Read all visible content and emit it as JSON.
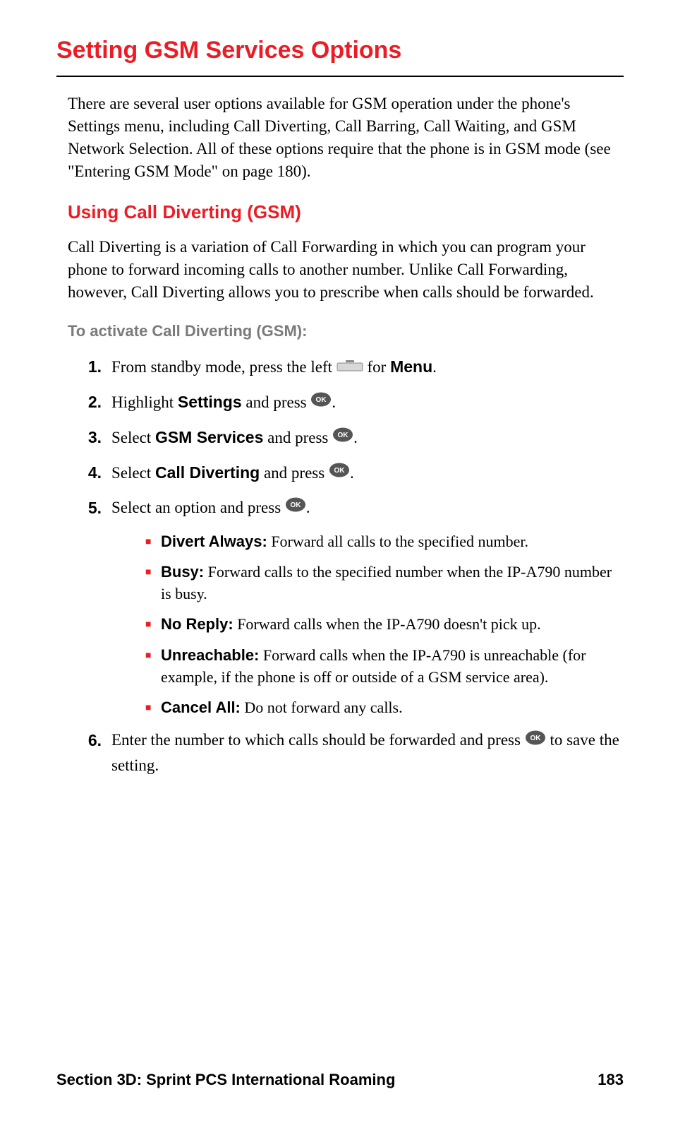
{
  "heading1": "Setting GSM Services Options",
  "intro": "There are several user options available for GSM operation under the phone's Settings menu, including Call Diverting, Call Barring, Call Waiting, and GSM Network Selection. All of these options require that the phone is in GSM mode (see \"Entering GSM Mode\" on page 180).",
  "heading2": "Using Call Diverting (GSM)",
  "para2": "Call Diverting is a variation of Call Forwarding in which you can program your phone to forward incoming calls to another number. Unlike Call Forwarding, however, Call Diverting allows you to prescribe when calls should be forwarded.",
  "subhead": "To activate Call Diverting (GSM):",
  "steps": {
    "s1": {
      "num": "1.",
      "a": "From standby mode, press the left ",
      "b": " for ",
      "bold": "Menu",
      "c": "."
    },
    "s2": {
      "num": "2.",
      "a": "Highlight ",
      "bold": "Settings",
      "b": " and press ",
      "c": "."
    },
    "s3": {
      "num": "3.",
      "a": "Select ",
      "bold": "GSM Services",
      "b": " and press ",
      "c": "."
    },
    "s4": {
      "num": "4.",
      "a": "Select ",
      "bold": "Call Diverting",
      "b": " and press ",
      "c": "."
    },
    "s5": {
      "num": "5.",
      "a": "Select an option and press ",
      "c": "."
    },
    "s6": {
      "num": "6.",
      "a": "Enter the number to which calls should be forwarded and press ",
      "b": " to save the setting."
    }
  },
  "bullets": {
    "b1": {
      "bold": "Divert Always:",
      "text": " Forward all calls to the specified number."
    },
    "b2": {
      "bold": "Busy:",
      "text": " Forward calls to the specified number when the IP-A790 number is busy."
    },
    "b3": {
      "bold": "No Reply:",
      "text": " Forward calls when the IP-A790 doesn't pick up."
    },
    "b4": {
      "bold": "Unreachable:",
      "text": " Forward calls when the IP-A790 is unreachable (for example, if the phone is off or outside of a GSM service area)."
    },
    "b5": {
      "bold": "Cancel All:",
      "text": " Do not forward any calls."
    }
  },
  "footer": {
    "section": "Section 3D: Sprint PCS International Roaming",
    "page": "183"
  },
  "icons": {
    "ok_label": "OK"
  }
}
